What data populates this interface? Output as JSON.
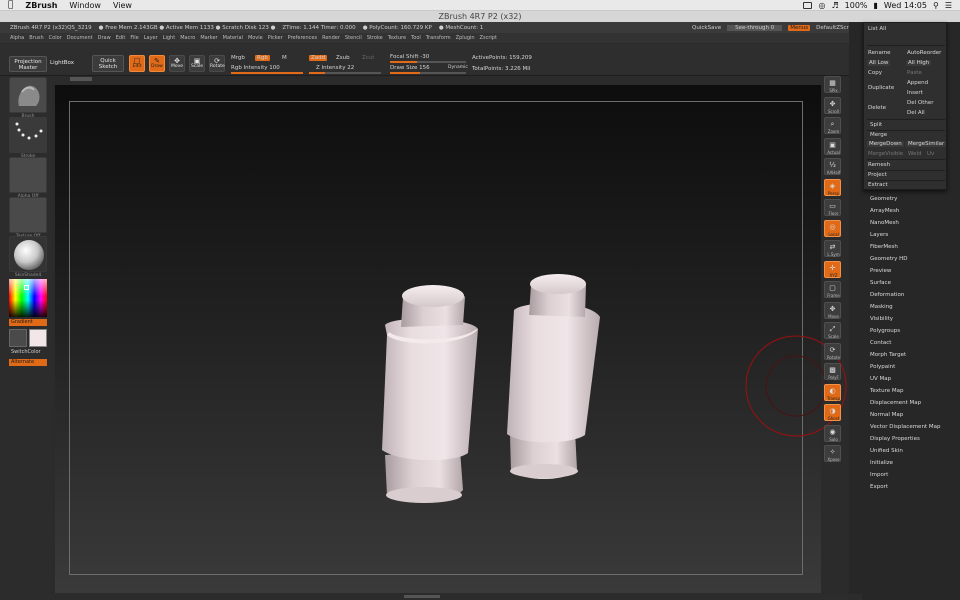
{
  "macbar": {
    "app_name": "ZBrush",
    "menus": [
      "Window",
      "View"
    ],
    "battery": "100%",
    "clock": "Wed 14:05"
  },
  "window": {
    "title": "ZBrush 4R7 P2 (x32)"
  },
  "infobar": {
    "app": "ZBrush 4R7 P2 (x32)QS_3219",
    "free_mem": "● Free Mem 2.143GB ● Active Mem 1133 ● Scratch Disk 123 ●",
    "timer": "ZTime: 1.144 Timer: 0.000",
    "polycount": "● PolyCount: 160.729 KP",
    "meshcount": "● MeshCount: 1",
    "quicksave": "QuickSave",
    "see_through": "See-through  0",
    "menus_btn": "Menus",
    "default_script": "DefaultZScript"
  },
  "menurow": [
    "Alpha",
    "Brush",
    "Color",
    "Document",
    "Draw",
    "Edit",
    "File",
    "Layer",
    "Light",
    "Macro",
    "Marker",
    "Material",
    "Movie",
    "Picker",
    "Preferences",
    "Render",
    "Stencil",
    "Stroke",
    "Texture",
    "Tool",
    "Transform",
    "Zplugin",
    "Zscript"
  ],
  "shelf": {
    "projection_master": "Projection Master",
    "lightbox": "LightBox",
    "quick_sketch": "Quick Sketch",
    "edit": "Edit",
    "draw": "Draw",
    "move": "Move",
    "scale": "Scale",
    "rotate": "Rotate",
    "mrgb": "Mrgb",
    "rgb": "Rgb",
    "m": "M",
    "rgb_intensity": "Rgb Intensity 100",
    "zadd": "Zadd",
    "zsub": "Zsub",
    "zcut": "Zcut",
    "z_intensity": "Z Intensity 22",
    "focal_shift": "Focal Shift -30",
    "draw_size": "Draw Size 156",
    "dynamic": "Dynamic",
    "active_points": "ActivePoints: 159,209",
    "total_points": "TotalPoints: 3.226 Mil"
  },
  "leftpanel": {
    "brush_label": "Brush",
    "stroke_label": "Stroke",
    "alpha_label": "Alpha Off",
    "texture_label": "Texture Off",
    "material_label": "SkinShade4",
    "gradient": "Gradient",
    "switchcolor": "SwitchColor",
    "alternate": "Alternate"
  },
  "rstrip": [
    {
      "label": "SPix",
      "on": false
    },
    {
      "label": "Scroll",
      "on": false
    },
    {
      "label": "Zoom",
      "on": false
    },
    {
      "label": "Actual",
      "on": false
    },
    {
      "label": "AAHalf",
      "on": false
    },
    {
      "label": "Persp",
      "on": true
    },
    {
      "label": "Floor",
      "on": false
    },
    {
      "label": "Local",
      "on": true
    },
    {
      "label": "L.Sym",
      "on": false
    },
    {
      "label": "XYZ",
      "on": true
    },
    {
      "label": "Frame",
      "on": false
    },
    {
      "label": "Move",
      "on": false
    },
    {
      "label": "Scale",
      "on": false
    },
    {
      "label": "Rotate",
      "on": false
    },
    {
      "label": "PolyF",
      "on": false
    },
    {
      "label": "Transp",
      "on": true
    },
    {
      "label": "Ghost",
      "on": true
    },
    {
      "label": "Solo",
      "on": false
    },
    {
      "label": "Xpose",
      "on": false
    }
  ],
  "subtool": {
    "list_all": "List All",
    "rename": "Rename",
    "autoreorder": "AutoReorder",
    "all_low": "All Low",
    "all_high": "All High",
    "copy": "Copy",
    "paste": "Paste",
    "duplicate": "Duplicate",
    "append": "Append",
    "insert": "Insert",
    "delete": "Delete",
    "del_other": "Del Other",
    "del_all": "Del All",
    "split": "Split",
    "merge": "Merge",
    "mergedown": "MergeDown",
    "mergesimilar": "MergeSimilar",
    "mergevisible": "MergeVisible",
    "weld": "Weld",
    "uv": "Uv",
    "remesh": "Remesh",
    "project": "Project",
    "extract": "Extract"
  },
  "tool_menu": [
    "Geometry",
    "ArrayMesh",
    "NanoMesh",
    "Layers",
    "FiberMesh",
    "Geometry HD",
    "Preview",
    "Surface",
    "Deformation",
    "Masking",
    "Visibility",
    "Polygroups",
    "Contact",
    "Morph Target",
    "Polypaint",
    "UV Map",
    "Texture Map",
    "Displacement Map",
    "Normal Map",
    "Vector Displacement Map",
    "Display Properties",
    "Unified Skin",
    "Initialize",
    "Import",
    "Export"
  ],
  "colors": {
    "accent": "#e06a17",
    "background": "#2b2b2b",
    "mesh": "#e6dadd"
  }
}
